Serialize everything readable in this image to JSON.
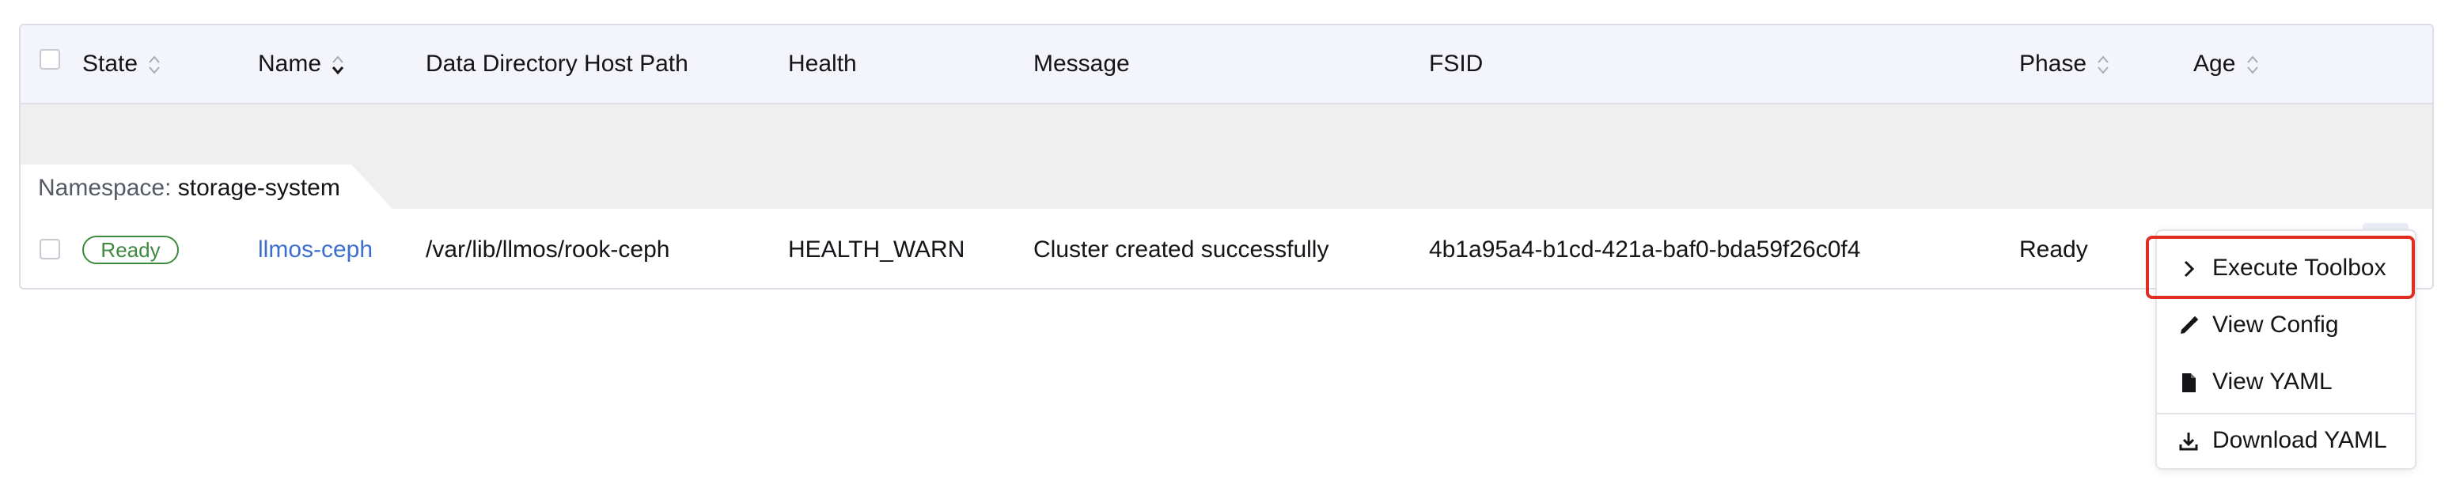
{
  "table": {
    "columns": {
      "state": "State",
      "name": "Name",
      "data_dir": "Data Directory Host Path",
      "health": "Health",
      "message": "Message",
      "fsid": "FSID",
      "phase": "Phase",
      "age": "Age"
    },
    "group": {
      "key": "Namespace:",
      "value": "storage-system"
    },
    "rows": [
      {
        "state": "Ready",
        "name": "llmos-ceph",
        "data_dir": "/var/lib/llmos/rook-ceph",
        "health": "HEALTH_WARN",
        "message": "Cluster created successfully",
        "fsid": "4b1a95a4-b1cd-421a-baf0-bda59f26c0f4",
        "phase": "Ready",
        "age": ""
      }
    ]
  },
  "menu": {
    "items": [
      {
        "label": "Execute Toolbox",
        "icon": "chevron-right-icon"
      },
      {
        "label": "View Config",
        "icon": "pencil-icon"
      },
      {
        "label": "View YAML",
        "icon": "file-icon"
      },
      {
        "label": "Download YAML",
        "icon": "download-icon"
      }
    ]
  },
  "colors": {
    "header_bg": "#f4f5fa",
    "group_bg": "#efefef",
    "ready_green": "#3d8a3f",
    "link_blue": "#3d6fcd",
    "highlight_red": "#e02d22"
  }
}
